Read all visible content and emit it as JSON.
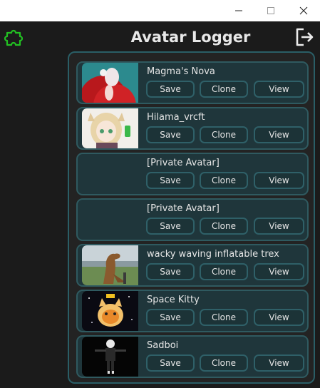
{
  "window": {
    "minimize_icon": "minimize-icon",
    "maximize_icon": "maximize-icon",
    "close_icon": "close-icon"
  },
  "header": {
    "title": "Avatar Logger",
    "left_icon": "puzzle-icon",
    "right_icon": "logout-icon"
  },
  "avatars": [
    {
      "name": "Magma's Nova",
      "thumb": "red-haired anime avatar",
      "save": "Save",
      "clone": "Clone",
      "view": "View"
    },
    {
      "name": "Hilama_vrcft",
      "thumb": "blonde anime avatar with cat ears",
      "save": "Save",
      "clone": "Clone",
      "view": "View"
    },
    {
      "name": "[Private Avatar]",
      "thumb": "",
      "save": "Save",
      "clone": "Clone",
      "view": "View"
    },
    {
      "name": "[Private Avatar]",
      "thumb": "",
      "save": "Save",
      "clone": "Clone",
      "view": "View"
    },
    {
      "name": "wacky waving inflatable trex",
      "thumb": "inflatable t-rex outdoors",
      "save": "Save",
      "clone": "Clone",
      "view": "View"
    },
    {
      "name": "Space Kitty",
      "thumb": "orange cat in space",
      "save": "Save",
      "clone": "Clone",
      "view": "View"
    },
    {
      "name": "Sadboi",
      "thumb": "dark humanoid avatar",
      "save": "Save",
      "clone": "Clone",
      "view": "View"
    }
  ],
  "colors": {
    "background": "#1b1b1b",
    "card": "#1f363b",
    "accent_border": "#2f5a60",
    "puzzle_icon": "#22c022"
  }
}
